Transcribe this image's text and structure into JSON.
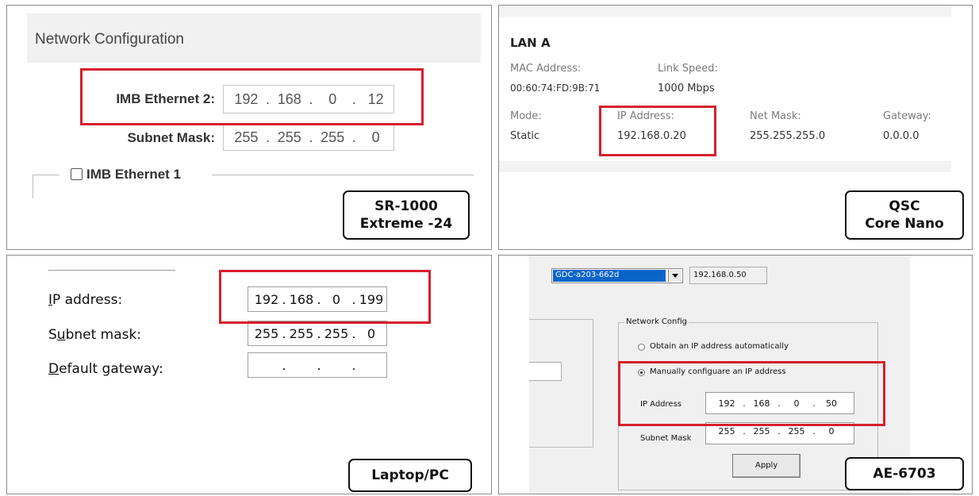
{
  "panels": {
    "sr1000": {
      "title": "Network Configuration",
      "ip_label": "IMB Ethernet 2:",
      "ip": [
        "192",
        "168",
        "0",
        "12"
      ],
      "subnet_label": "Subnet Mask:",
      "subnet": [
        "255",
        "255",
        "255",
        "0"
      ],
      "eth1_label": "IMB Ethernet 1",
      "eth1_checked": false,
      "device_label": [
        "SR-1000",
        "Extreme -24"
      ]
    },
    "qsc": {
      "section_title": "LAN A",
      "mac_label": "MAC Address:",
      "mac_value": "00:60:74:FD:9B:71",
      "link_label": "Link Speed:",
      "link_value": "1000 Mbps",
      "mode_label": "Mode:",
      "mode_value": "Static",
      "ip_label": "IP Address:",
      "ip_value": "192.168.0.20",
      "mask_label": "Net Mask:",
      "mask_value": "255.255.255.0",
      "gateway_label": "Gateway:",
      "gateway_value": "0.0.0.0",
      "device_label": [
        "QSC",
        "Core Nano"
      ]
    },
    "pc": {
      "ip_label": "IP address:",
      "ip": [
        "192",
        "168",
        "0",
        "199"
      ],
      "subnet_label": "Subnet mask:",
      "subnet": [
        "255",
        "255",
        "255",
        "0"
      ],
      "gateway_label": "Default gateway:",
      "gateway": [
        "",
        "",
        "",
        ""
      ],
      "device_label": [
        "Laptop/PC"
      ]
    },
    "ae6703": {
      "device_select": "GDC-a203-662d",
      "device_ip": "192.168.0.50",
      "group_title": "Network Config",
      "radio_auto": "Obtain an IP address automatically",
      "radio_manual": "Manually configuare an IP address",
      "selected_radio": "manual",
      "ip_label": "IP Address",
      "ip": [
        "192",
        "168",
        "0",
        "50"
      ],
      "subnet_label": "Subnet Mask",
      "subnet": [
        "255",
        "255",
        "255",
        "0"
      ],
      "apply_label": "Apply",
      "device_label": [
        "AE-6703"
      ]
    }
  },
  "colors": {
    "highlight": "#d61f2c",
    "select_bg": "#0a64c8"
  },
  "icons": {
    "checkbox": "checkbox-empty",
    "dropdown": "chevron-down-icon"
  }
}
